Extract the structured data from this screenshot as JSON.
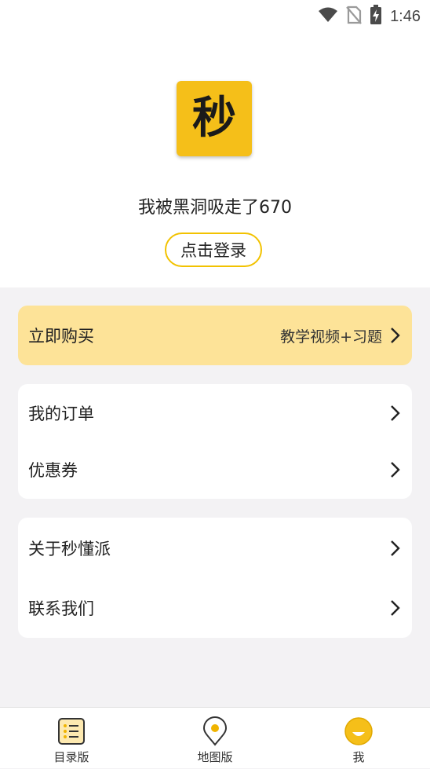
{
  "status_bar": {
    "time": "1:46",
    "icons": [
      "wifi-icon",
      "no-sim-icon",
      "battery-charging-icon"
    ]
  },
  "profile": {
    "logo_char": "秒",
    "username": "我被黑洞吸走了670",
    "login_label": "点击登录"
  },
  "buy": {
    "label": "立即购买",
    "extra": "教学视频+习题"
  },
  "menu_group_1": [
    {
      "label": "我的订单"
    },
    {
      "label": "优惠券"
    }
  ],
  "menu_group_2": [
    {
      "label": "关于秒懂派"
    },
    {
      "label": "联系我们"
    }
  ],
  "tabs": [
    {
      "label": "目录版",
      "icon": "catalog-icon"
    },
    {
      "label": "地图版",
      "icon": "map-pin-icon"
    },
    {
      "label": "我",
      "icon": "profile-face-icon",
      "active": true
    }
  ],
  "colors": {
    "accent": "#f5bf19",
    "buy_bg": "#fde398",
    "page_bg": "#f3f2f4"
  }
}
